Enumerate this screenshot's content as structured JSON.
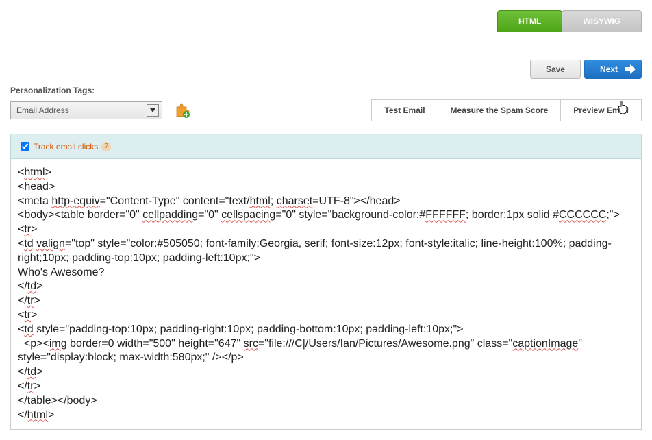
{
  "tabs": {
    "html": "HTML",
    "wysiwyg": "WISYWIG"
  },
  "actions": {
    "save": "Save",
    "next": "Next"
  },
  "personalization": {
    "label": "Personalization Tags:",
    "selected": "Email Address"
  },
  "right_buttons": {
    "test": "Test Email",
    "spam": "Measure the Spam Score",
    "preview": "Preview Email"
  },
  "track": {
    "label": "Track email clicks"
  },
  "code": {
    "l1a": "<",
    "l1b": "html",
    "l1c": ">",
    "l2": "<head>",
    "l3a": "<meta ",
    "l3b": "http-equiv",
    "l3c": "=\"Content-Type\" content=\"text/",
    "l3d": "html",
    "l3e": "; ",
    "l3f": "charset",
    "l3g": "=UTF-8\"></head>",
    "l4a": "<body><table border=\"0\" ",
    "l4b": "cellpadding",
    "l4c": "=\"0\" ",
    "l4d": "cellspacing",
    "l4e": "=\"0\" style=\"background-color:#",
    "l4f": "FFFFFF",
    "l4g": "; border:1px solid #",
    "l4h": "CCCCCC",
    "l4i": ";\">",
    "l5a": "<",
    "l5b": "tr",
    "l5c": ">",
    "l6a": "<",
    "l6b": "td",
    "l6c": " ",
    "l6d": "valign",
    "l6e": "=\"top\" style=\"color:#505050; font-family:Georgia, serif; font-size:12px; font-style:italic; line-height:100%; padding-right;10px; padding-top:10px; padding-left:10px;\">",
    "l7": "Who's Awesome?",
    "l8a": "</",
    "l8b": "td",
    "l8c": ">",
    "l9a": "</",
    "l9b": "tr",
    "l9c": ">",
    "l10a": "<",
    "l10b": "tr",
    "l10c": ">",
    "l11a": "<",
    "l11b": "td",
    "l11c": " style=\"padding-top:10px; padding-right:10px; padding-bottom:10px; padding-left:10px;\">",
    "l12a": "  <p><",
    "l12b": "img",
    "l12c": " border=0 width=\"500\" height=\"647\" ",
    "l12d": "src",
    "l12e": "=\"file:///C|/Users/Ian/Pictures/Awesome.png\" class=\"",
    "l12f": "captionImage",
    "l12g": "\" style=\"display:block; max-width:580px;\" /></p>",
    "l13a": "</",
    "l13b": "td",
    "l13c": ">",
    "l14a": "</",
    "l14b": "tr",
    "l14c": ">",
    "l15": "</table></body>",
    "l16a": "</",
    "l16b": "html",
    "l16c": ">"
  }
}
